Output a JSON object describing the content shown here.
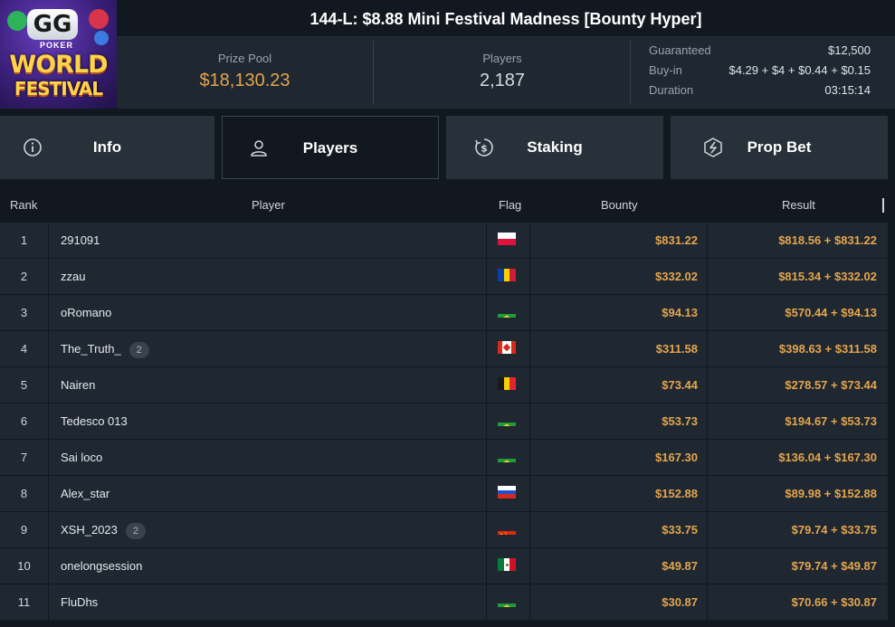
{
  "logo": {
    "brand": "GG",
    "sub": "POKER",
    "line1": "WORLD",
    "line2": "FESTIVAL"
  },
  "title": "144-L: $8.88 Mini Festival Madness [Bounty Hyper]",
  "stats": {
    "prize_pool_label": "Prize Pool",
    "prize_pool_value": "$18,130.23",
    "players_label": "Players",
    "players_value": "2,187"
  },
  "details": {
    "guaranteed_label": "Guaranteed",
    "guaranteed_value": "$12,500",
    "buyin_label": "Buy-in",
    "buyin_value": "$4.29 + $4 + $0.44 + $0.15",
    "duration_label": "Duration",
    "duration_value": "03:15:14"
  },
  "tabs": [
    {
      "label": "Info",
      "icon": "info-icon"
    },
    {
      "label": "Players",
      "icon": "user-icon",
      "active": true
    },
    {
      "label": "Staking",
      "icon": "dollar-icon"
    },
    {
      "label": "Prop Bet",
      "icon": "lightning-icon"
    }
  ],
  "colors": {
    "accent": "#e3a54e",
    "row_bg": "#1f2731",
    "page_bg": "#12181f",
    "tab_bg": "#283039"
  },
  "table": {
    "headers": {
      "rank": "Rank",
      "player": "Player",
      "flag": "Flag",
      "bounty": "Bounty",
      "result": "Result"
    },
    "rows": [
      {
        "rank": "1",
        "player": "291091",
        "badge": "",
        "flag": "PL",
        "bounty": "$831.22",
        "result": "$818.56 + $831.22"
      },
      {
        "rank": "2",
        "player": "zzau",
        "badge": "",
        "flag": "AD",
        "bounty": "$332.02",
        "result": "$815.34 + $332.02"
      },
      {
        "rank": "3",
        "player": "oRomano",
        "badge": "",
        "flag": "BR",
        "bounty": "$94.13",
        "result": "$570.44 + $94.13"
      },
      {
        "rank": "4",
        "player": "The_Truth_",
        "badge": "2",
        "flag": "CA",
        "bounty": "$311.58",
        "result": "$398.63 + $311.58"
      },
      {
        "rank": "5",
        "player": "Nairen",
        "badge": "",
        "flag": "BE",
        "bounty": "$73.44",
        "result": "$278.57 + $73.44"
      },
      {
        "rank": "6",
        "player": "Tedesco 013",
        "badge": "",
        "flag": "BR",
        "bounty": "$53.73",
        "result": "$194.67 + $53.73"
      },
      {
        "rank": "7",
        "player": "Sai loco",
        "badge": "",
        "flag": "BR",
        "bounty": "$167.30",
        "result": "$136.04 + $167.30"
      },
      {
        "rank": "8",
        "player": "Alex_star",
        "badge": "",
        "flag": "RU",
        "bounty": "$152.88",
        "result": "$89.98 + $152.88"
      },
      {
        "rank": "9",
        "player": "XSH_2023",
        "badge": "2",
        "flag": "CN",
        "bounty": "$33.75",
        "result": "$79.74 + $33.75"
      },
      {
        "rank": "10",
        "player": "onelongsession",
        "badge": "",
        "flag": "MX",
        "bounty": "$49.87",
        "result": "$79.74 + $49.87"
      },
      {
        "rank": "11",
        "player": "FluDhs",
        "badge": "",
        "flag": "BR",
        "bounty": "$30.87",
        "result": "$70.66 + $30.87"
      }
    ]
  }
}
